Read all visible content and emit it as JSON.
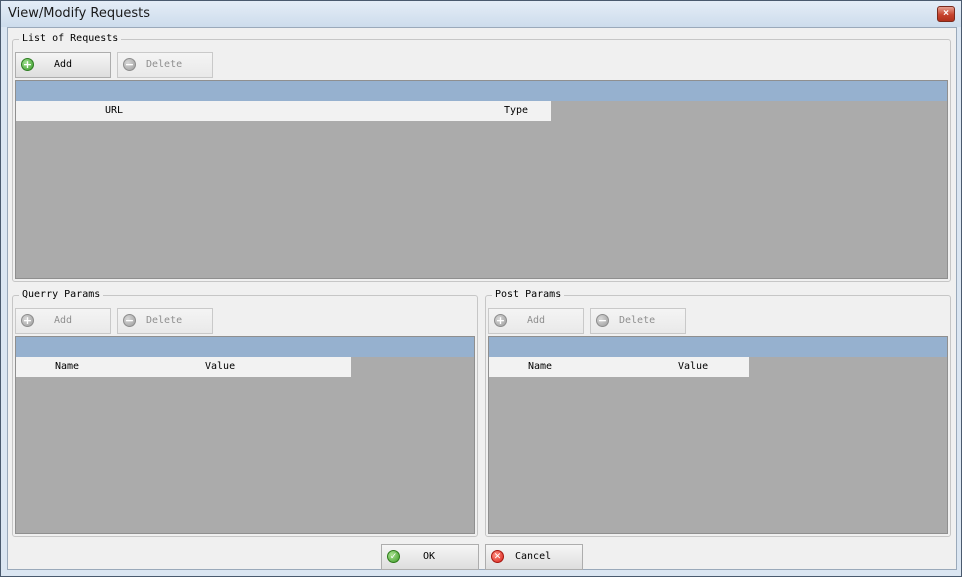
{
  "window": {
    "title": "View/Modify Requests",
    "close_glyph": "×"
  },
  "requests": {
    "group_title": "List of Requests",
    "add_label": "Add",
    "delete_label": "Delete",
    "columns": [
      "URL",
      "Type"
    ]
  },
  "query_params": {
    "group_title": "Querry Params",
    "add_label": "Add",
    "delete_label": "Delete",
    "columns": [
      "Name",
      "Value"
    ]
  },
  "post_params": {
    "group_title": "Post Params",
    "add_label": "Add",
    "delete_label": "Delete",
    "columns": [
      "Name",
      "Value"
    ]
  },
  "footer": {
    "ok_label": "OK",
    "cancel_label": "Cancel"
  },
  "icons": {
    "add": "plus-circle-icon",
    "delete": "minus-circle-icon",
    "ok": "check-circle-icon",
    "cancel": "x-circle-icon",
    "close": "close-icon"
  },
  "colors": {
    "grid_header_band": "#96b1cf",
    "grid_body": "#ababab",
    "dialog_bg": "#f0f0f0",
    "close_button": "#c7432e"
  }
}
